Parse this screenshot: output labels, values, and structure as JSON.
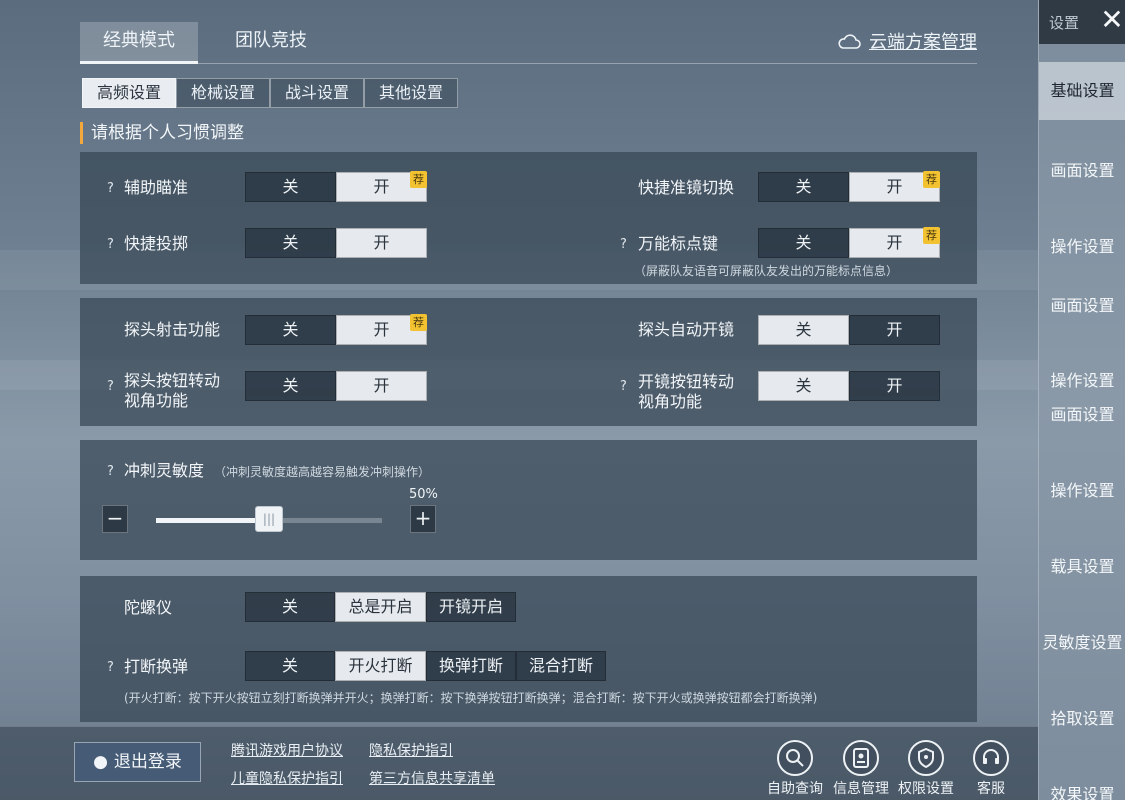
{
  "mode_tabs": {
    "classic": "经典模式",
    "team": "团队竞技",
    "cloud": "云端方案管理"
  },
  "sub_tabs": [
    "高频设置",
    "枪械设置",
    "战斗设置",
    "其他设置"
  ],
  "hint": "请根据个人习惯调整",
  "toggles": {
    "off": "关",
    "on": "开",
    "recommend": "荐",
    "aim_assist": "辅助瞄准",
    "quick_scope": "快捷准镜切换",
    "quick_throw": "快捷投掷",
    "universal_mark": "万能标点键",
    "universal_mark_note": "（屏蔽队友语音可屏蔽队友发出的万能标点信息）",
    "peek_fire": "探头射击功能",
    "peek_auto_scope": "探头自动开镜",
    "peek_rotate_1": "探头按钮转动",
    "peek_rotate_2": "视角功能",
    "scope_rotate_1": "开镜按钮转动",
    "scope_rotate_2": "视角功能"
  },
  "sprint": {
    "label": "冲刺灵敏度",
    "note": "（冲刺灵敏度越高越容易触发冲刺操作）",
    "percent": "50%",
    "value": 0.5,
    "minus": "−",
    "plus": "+"
  },
  "gyro": {
    "label": "陀螺仪",
    "off": "关",
    "always": "总是开启",
    "scope": "开镜开启"
  },
  "reload": {
    "label": "打断换弹",
    "off": "关",
    "fire": "开火打断",
    "reload": "换弹打断",
    "mixed": "混合打断",
    "note": "(开火打断：按下开火按钮立刻打断换弹并开火；换弹打断：按下换弹按钮打断换弹；混合打断：按下开火或换弹按钮都会打断换弹)"
  },
  "bottom": {
    "logout": "退出登录",
    "links": [
      "腾讯游戏用户协议",
      "隐私保护指引",
      "儿童隐私保护指引",
      "第三方信息共享清单"
    ],
    "tools": [
      "自助查询",
      "信息管理",
      "权限设置",
      "客服"
    ]
  },
  "sidebar": {
    "title": "设置",
    "items": [
      "基础设置",
      "画面设置",
      "操作设置",
      "画面设置",
      "操作设置",
      "画面设置",
      "操作设置",
      "载具设置",
      "灵敏度设置",
      "拾取设置",
      "效果设置"
    ]
  }
}
